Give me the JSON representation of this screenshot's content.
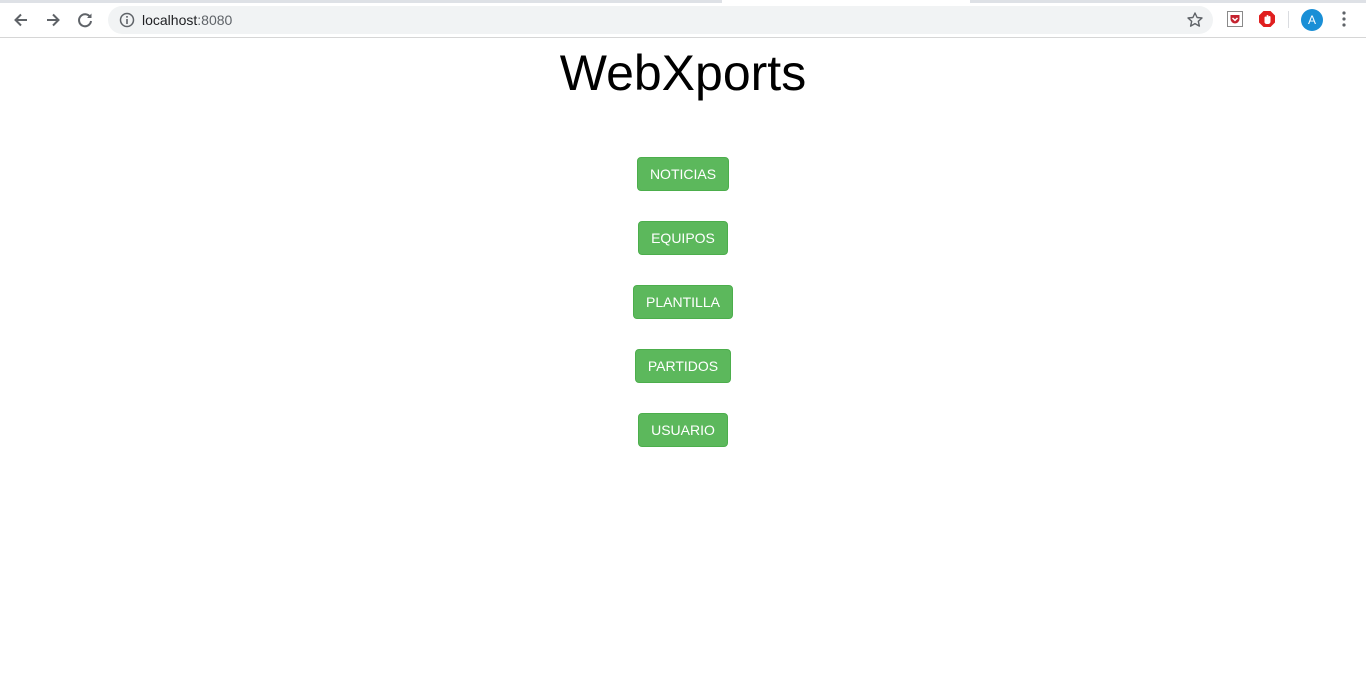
{
  "browser": {
    "url_host": "localhost",
    "url_port": ":8080",
    "profile_initial": "A",
    "icons": {
      "back": "back-arrow-icon",
      "forward": "forward-arrow-icon",
      "reload": "reload-icon",
      "info": "info-icon",
      "bookmark": "star-icon",
      "pocket": "pocket-extension-icon",
      "adblock": "adblock-extension-icon",
      "menu": "kebab-menu-icon"
    },
    "colors": {
      "avatar": "#1a8fd6",
      "adblock": "#e01f1f",
      "pocket": "#c4222e"
    }
  },
  "page": {
    "title": "WebXports",
    "buttons": [
      {
        "label": "NOTICIAS"
      },
      {
        "label": "EQUIPOS"
      },
      {
        "label": "PLANTILLA"
      },
      {
        "label": "PARTIDOS"
      },
      {
        "label": "USUARIO"
      }
    ],
    "colors": {
      "button_bg": "#5cb85c",
      "button_border": "#4cae4c",
      "button_text": "#ffffff"
    }
  }
}
